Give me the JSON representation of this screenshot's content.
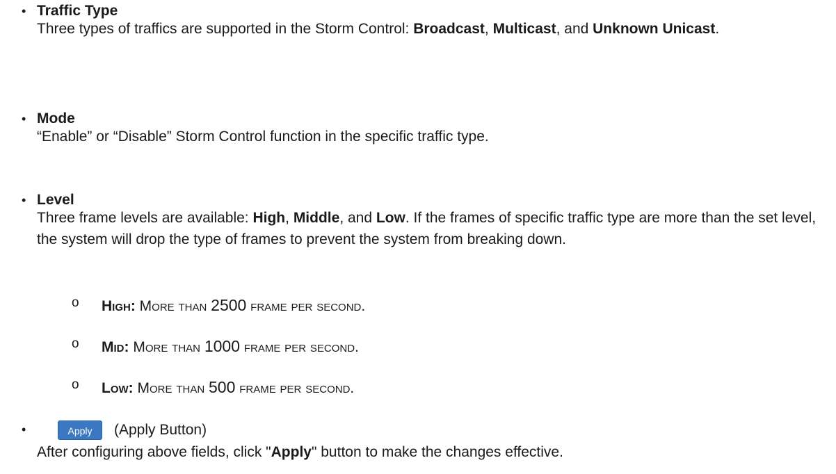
{
  "items": [
    {
      "term": "Traffic Type",
      "desc_prefix": "Three types of traffics are supported in the Storm Control: ",
      "b1": "Broadcast",
      "sep1": ", ",
      "b2": "Multicast",
      "sep2": ", and ",
      "b3": "Unknown Unicast",
      "suffix": "."
    },
    {
      "term": "Mode",
      "desc": "“Enable” or “Disable” Storm Control function in the specific traffic type."
    },
    {
      "term": "Level",
      "desc_prefix": "Three frame levels are available: ",
      "b1": "High",
      "sep1": ", ",
      "b2": "Middle",
      "sep2": ", and ",
      "b3": "Low",
      "suffix": ". If the frames of specific traffic type are more than the set level, the system will drop the type of frames to prevent the system from breaking down."
    }
  ],
  "levels": [
    {
      "bullet": "o",
      "label": "High:",
      "text_pre": " More than ",
      "number": "2500",
      "text_post": " frame per second."
    },
    {
      "bullet": "o",
      "label": "Mid:",
      "text_pre": " More than ",
      "number": "1000",
      "text_post": " frame per second."
    },
    {
      "bullet": "o",
      "label": "Low:",
      "text_pre": " More than ",
      "number": "500",
      "text_post": " frame per second."
    }
  ],
  "apply": {
    "button_label": "Apply",
    "caption": "(Apply Button)",
    "desc_prefix": "After configuring above fields, click \"",
    "desc_bold": "Apply",
    "desc_suffix": "\" button to make the changes effective."
  },
  "bullet_char": "•"
}
